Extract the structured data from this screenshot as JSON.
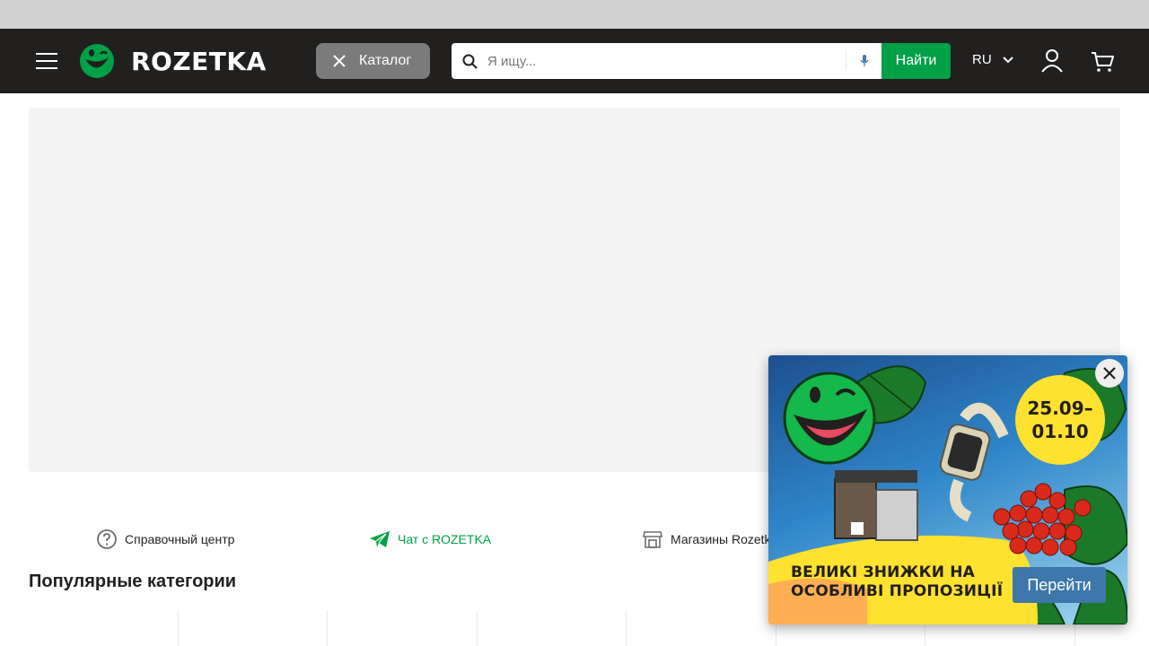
{
  "header": {
    "logo_text": "ROZETKA",
    "catalog_label": "Каталог",
    "search_placeholder": "Я ищу...",
    "search_button": "Найти",
    "language": "RU"
  },
  "colors": {
    "header_bg": "#221f1f",
    "accent_green": "#00a046",
    "catalog_btn": "#7b7b7b",
    "banner_placeholder": "#f4f4f4",
    "popup_button": "#3e77aa",
    "date_circle": "#ffe130"
  },
  "icons": {
    "menu": "hamburger-icon",
    "catalog_close": "close-icon",
    "search": "search-icon",
    "mic": "microphone-icon",
    "lang": "chevron-down-icon",
    "user": "user-icon",
    "cart": "cart-icon",
    "help": "question-circle-icon",
    "chat": "telegram-icon",
    "stores": "store-icon"
  },
  "links": [
    {
      "label": "Справочный центр"
    },
    {
      "label": "Чат с ROZETKA"
    },
    {
      "label": "Магазины Rozetka"
    }
  ],
  "popular": {
    "title": "Популярные категории"
  },
  "promo": {
    "date_start": "25.09–",
    "date_end": "01.10",
    "line1": "ВЕЛИКІ ЗНИЖКИ НА",
    "line2": "ОСОБЛИВІ ПРОПОЗИЦІЇ",
    "button": "Перейти"
  }
}
